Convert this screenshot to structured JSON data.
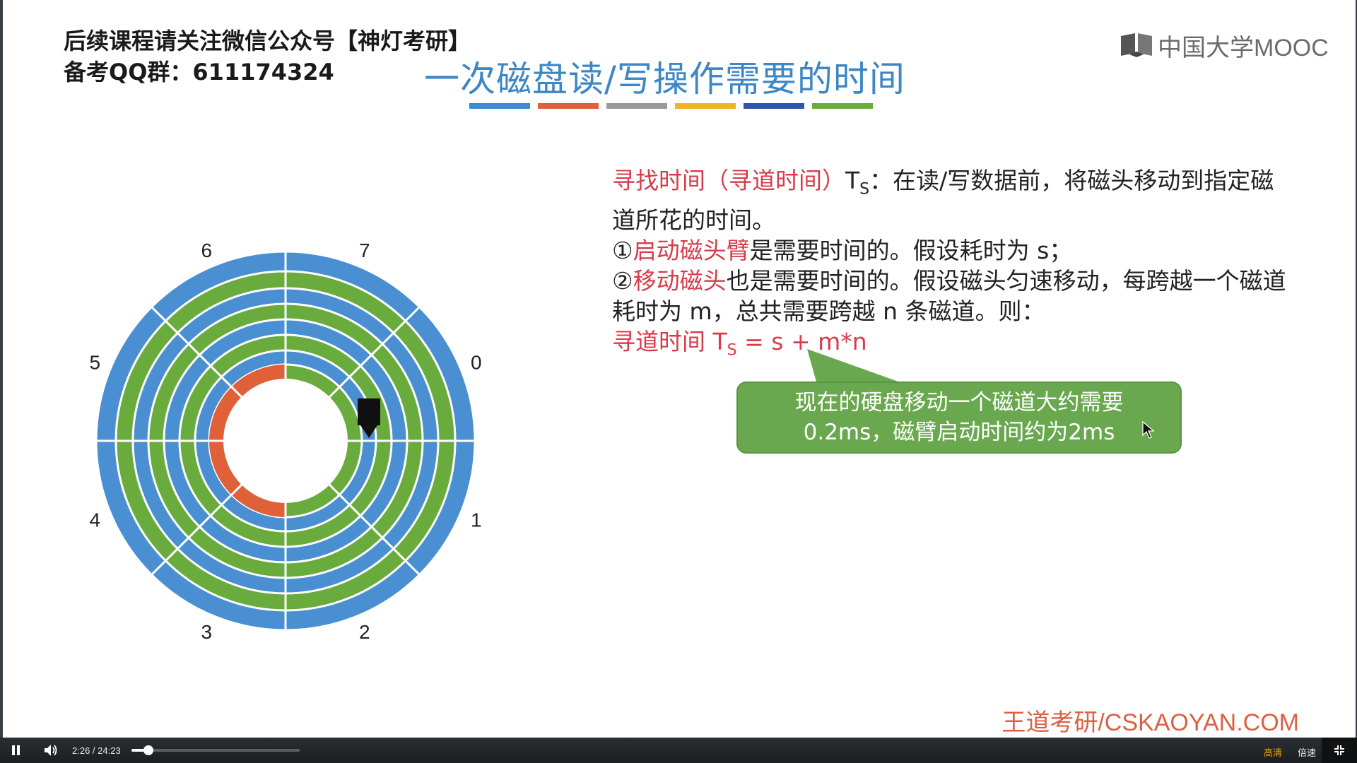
{
  "slide": {
    "note_line1": "后续课程请关注微信公众号【神灯考研】",
    "note_line2": "备考QQ群：611174324",
    "logo_text": "中国大学MOOC",
    "title": "一次磁盘读/写操作需要的时间",
    "title_bar_colors": [
      "#3d8bd1",
      "#e0603a",
      "#9a9a9a",
      "#f0b323",
      "#2f56a8",
      "#6aab3e"
    ],
    "sector_labels": [
      "0",
      "1",
      "2",
      "3",
      "4",
      "5",
      "6",
      "7"
    ],
    "seek_term": "寻找时间（寻道时间）",
    "seek_symbol": "T",
    "seek_sub": "S",
    "seek_def": "：在读/写数据前，将磁头移动到指定磁道所花的时间。",
    "item1_marker": "①",
    "item1_term": "启动磁头臂",
    "item1_text": "是需要时间的。假设耗时为 s；",
    "item2_marker": "②",
    "item2_term": "移动磁头",
    "item2_text": "也是需要时间的。假设磁头匀速移动，每跨越一个磁道耗时为 m，总共需要跨越 n 条磁道。则：",
    "formula_prefix": "寻道时间 T",
    "formula_sub": "S",
    "formula_rest": " = s + m*n",
    "callout_line1": "现在的硬盘移动一个磁道大约需要",
    "callout_line2": "0.2ms，磁臂启动时间约为2ms",
    "watermark": "王道考研/CSKAOYAN.COM",
    "colors": {
      "blue_track": "#4a8fd2",
      "green_track": "#6aab3e",
      "orange_track": "#e0603a",
      "red_text": "#d83b4a"
    }
  },
  "player": {
    "time": "2:26 / 24:23",
    "progress": 0.1,
    "quality_label": "高清",
    "speed_label": "倍速"
  }
}
